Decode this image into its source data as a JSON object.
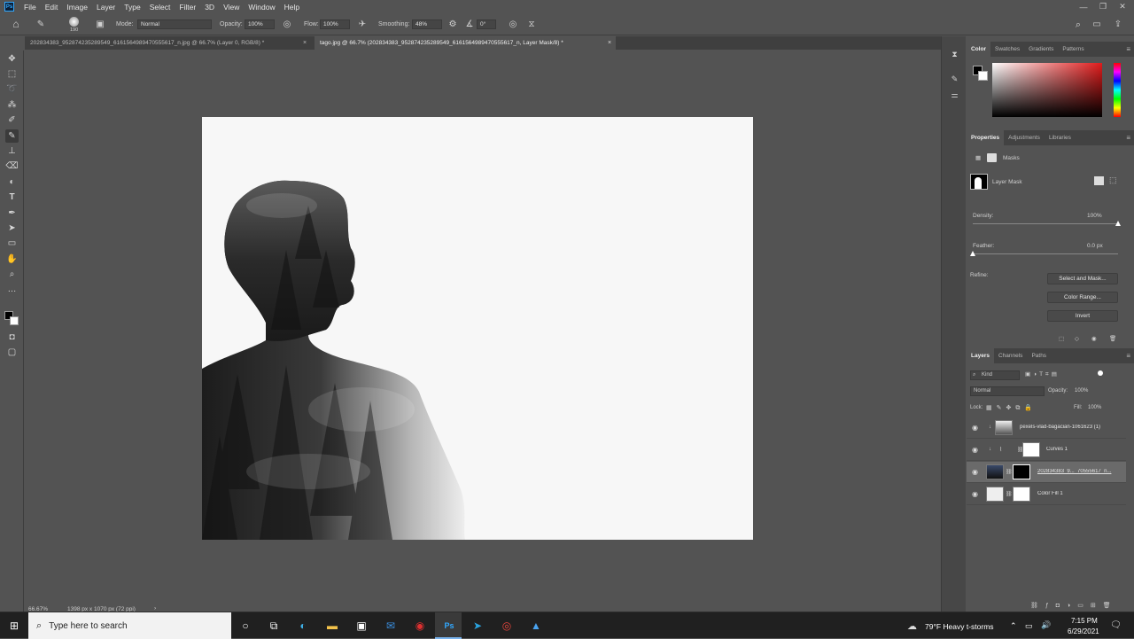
{
  "app": {
    "logo": "Ps"
  },
  "menu": [
    "File",
    "Edit",
    "Image",
    "Layer",
    "Type",
    "Select",
    "Filter",
    "3D",
    "View",
    "Window",
    "Help"
  ],
  "options": {
    "brush_size": "190",
    "mode_label": "Mode:",
    "mode_value": "Normal",
    "opacity_label": "Opacity:",
    "opacity_value": "100%",
    "flow_label": "Flow:",
    "flow_value": "100%",
    "smoothing_label": "Smoothing:",
    "smoothing_value": "48%",
    "angle_value": "0°"
  },
  "tabs": [
    {
      "label": "202834383_952874235289549_6161564989470555617_n.jpg @ 66.7% (Layer 0, RGB/8) *"
    },
    {
      "label": "tago.jpg @ 66.7% (202834383_952874235289549_6161564989470555617_n, Layer Mask/8) *"
    }
  ],
  "status": {
    "zoom": "66.67%",
    "doc_info": "1398 px x 1070 px (72 ppi)"
  },
  "color_panel": {
    "tabs": [
      "Color",
      "Swatches",
      "Gradients",
      "Patterns"
    ]
  },
  "properties": {
    "tabs": [
      "Properties",
      "Adjustments",
      "Libraries"
    ],
    "masks_label": "Masks",
    "layer_mask_label": "Layer Mask",
    "density_label": "Density:",
    "density_value": "100%",
    "density_level": 1.0,
    "feather_label": "Feather:",
    "feather_value": "0.0 px",
    "feather_level": 0.0,
    "refine_label": "Refine:",
    "select_and_mask": "Select and Mask...",
    "color_range": "Color Range...",
    "invert": "Invert"
  },
  "layers_panel": {
    "tabs": [
      "Layers",
      "Channels",
      "Paths"
    ],
    "kind_label": "Kind",
    "blend_mode": "Normal",
    "opacity_label": "Opacity:",
    "opacity_value": "100%",
    "lock_label": "Lock:",
    "fill_label": "Fill:",
    "fill_value": "100%",
    "layers": [
      {
        "name": "pexels-vlad-bagacian-1061623 (1)"
      },
      {
        "name": "Curves 1"
      },
      {
        "name": "202834383_9..._70555617_n..."
      },
      {
        "name": "Color Fill 1"
      }
    ]
  },
  "taskbar": {
    "search_placeholder": "Type here to search",
    "weather": "79°F  Heavy t-storms",
    "time": "7:15 PM",
    "date": "6/29/2021"
  }
}
